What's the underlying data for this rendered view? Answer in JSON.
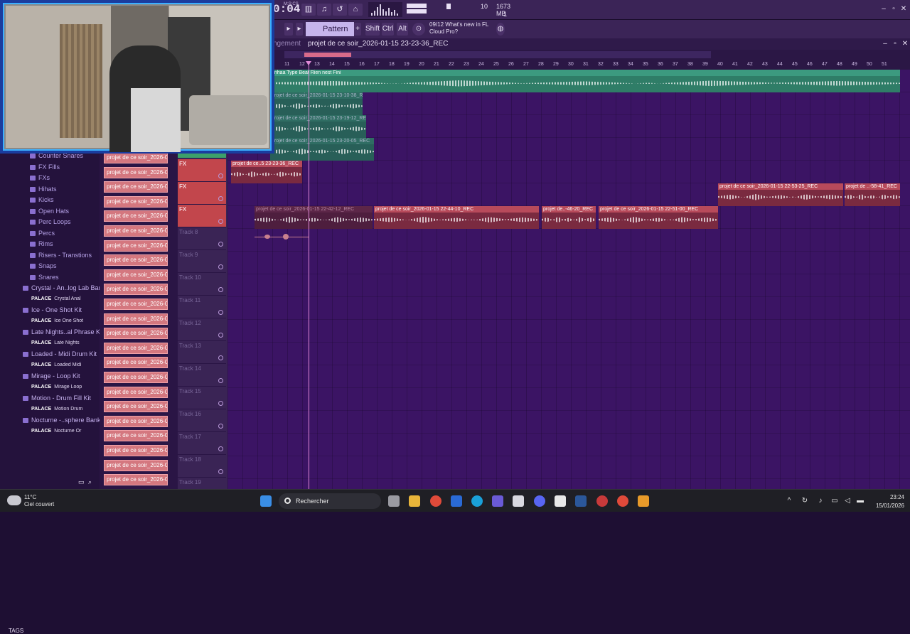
{
  "topbar": {
    "time": "0:04",
    "time_unit": "M:S:CS",
    "cpu": {
      "value1": "10",
      "memory": "1673 MB",
      "value2": "1"
    },
    "window_controls": [
      "minimize-icon",
      "maximize-icon",
      "close-icon"
    ]
  },
  "toolbar2": {
    "pattern": "Pattern 1",
    "add": "+",
    "shift": "Shift",
    "ctrl": "Ctrl",
    "alt": "Alt",
    "news_line1": "09/12  What's new in FL",
    "news_line2": "Cloud Pro?"
  },
  "playlist": {
    "tab": "ngement",
    "title": "projet de ce soir_2026-01-15 23-23-36_REC",
    "ruler": [
      "11",
      "12",
      "13",
      "14",
      "15",
      "16",
      "17",
      "18",
      "19",
      "20",
      "21",
      "22",
      "23",
      "24",
      "25",
      "26",
      "27",
      "28",
      "29",
      "30",
      "31",
      "32",
      "33",
      "34",
      "35",
      "36",
      "37",
      "38",
      "39",
      "40",
      "41",
      "42",
      "43",
      "44",
      "45",
      "46",
      "47",
      "48",
      "49",
      "50",
      "51"
    ]
  },
  "browser": {
    "items": [
      {
        "type": "folder",
        "label": "Counter Snares"
      },
      {
        "type": "folder",
        "label": "FX Fills"
      },
      {
        "type": "folder",
        "label": "FXs"
      },
      {
        "type": "folder",
        "label": "Hihats"
      },
      {
        "type": "folder",
        "label": "Kicks"
      },
      {
        "type": "folder",
        "label": "Open Hats"
      },
      {
        "type": "folder",
        "label": "Perc Loops"
      },
      {
        "type": "folder",
        "label": "Percs"
      },
      {
        "type": "folder",
        "label": "Rims"
      },
      {
        "type": "folder",
        "label": "Risers - Transtions"
      },
      {
        "type": "folder",
        "label": "Snaps"
      },
      {
        "type": "folder",
        "label": "Snares"
      },
      {
        "type": "pack",
        "label": "Crystal - An..log Lab Bank"
      },
      {
        "type": "palace",
        "label": "PALACE",
        "sub": "Crystal Anal"
      },
      {
        "type": "pack",
        "label": "Ice - One Shot Kit"
      },
      {
        "type": "palace",
        "label": "PALACE",
        "sub": "Ice One Shot"
      },
      {
        "type": "pack",
        "label": "Late Nights..al Phrase Kit"
      },
      {
        "type": "palace",
        "label": "PALACE",
        "sub": "Late Nights"
      },
      {
        "type": "pack",
        "label": "Loaded - Midi Drum Kit"
      },
      {
        "type": "palace",
        "label": "PALACE",
        "sub": "Loaded Midi"
      },
      {
        "type": "pack",
        "label": "Mirage - Loop Kit"
      },
      {
        "type": "palace",
        "label": "PALACE",
        "sub": "Mirage Loop"
      },
      {
        "type": "pack",
        "label": "Motion - Drum Fill Kit"
      },
      {
        "type": "palace",
        "label": "PALACE",
        "sub": "Motion Drum"
      },
      {
        "type": "pack",
        "label": "Nocturne -..sphere Bank"
      },
      {
        "type": "palace",
        "label": "PALACE",
        "sub": "Nocturne Or"
      }
    ],
    "tags": "TAGS"
  },
  "channels": {
    "label": "projet de ce soir_2026-0..",
    "count": 23
  },
  "tracks": [
    {
      "label": "FX",
      "fx": true
    },
    {
      "label": "FX",
      "fx": true
    },
    {
      "label": "FX",
      "fx": true
    },
    {
      "label": "Track 8"
    },
    {
      "label": "Track 9"
    },
    {
      "label": "Track 10"
    },
    {
      "label": "Track 11"
    },
    {
      "label": "Track 12"
    },
    {
      "label": "Track 13"
    },
    {
      "label": "Track 14"
    },
    {
      "label": "Track 15"
    },
    {
      "label": "Track 16"
    },
    {
      "label": "Track 17"
    },
    {
      "label": "Track 18"
    },
    {
      "label": "Track 19"
    }
  ],
  "clips": {
    "beat": "unhaa Type Beat Rien nest Fini",
    "c1": "projet de ce soir_2026-01-15 23-10-38_REC",
    "c2": "projet de ce soir_2026-01-15 23-19-12_REC",
    "c3": "projet de ce soir_2026-01-15 23-20-05_REC",
    "c4": "projet de ce..5 23-23-36_REC",
    "c5": "projet de ce soir_2026-01-15 22-53-25_REC",
    "c6": "projet de ..-58-41_REC",
    "c7": "projet de ce soir_2026-01-15 22-42-12_REC",
    "c8": "projet de ce soir_2026-01-15 22-44-10_REC",
    "c9": "projet de..-46-20_REC",
    "c10": "projet de ce soir_2026-01-15 22-51-00_REC"
  },
  "taskbar": {
    "temp": "11°C",
    "weather": "Ciel couvert",
    "search": "Rechercher",
    "time": "23:24",
    "date": "15/01/2026"
  }
}
